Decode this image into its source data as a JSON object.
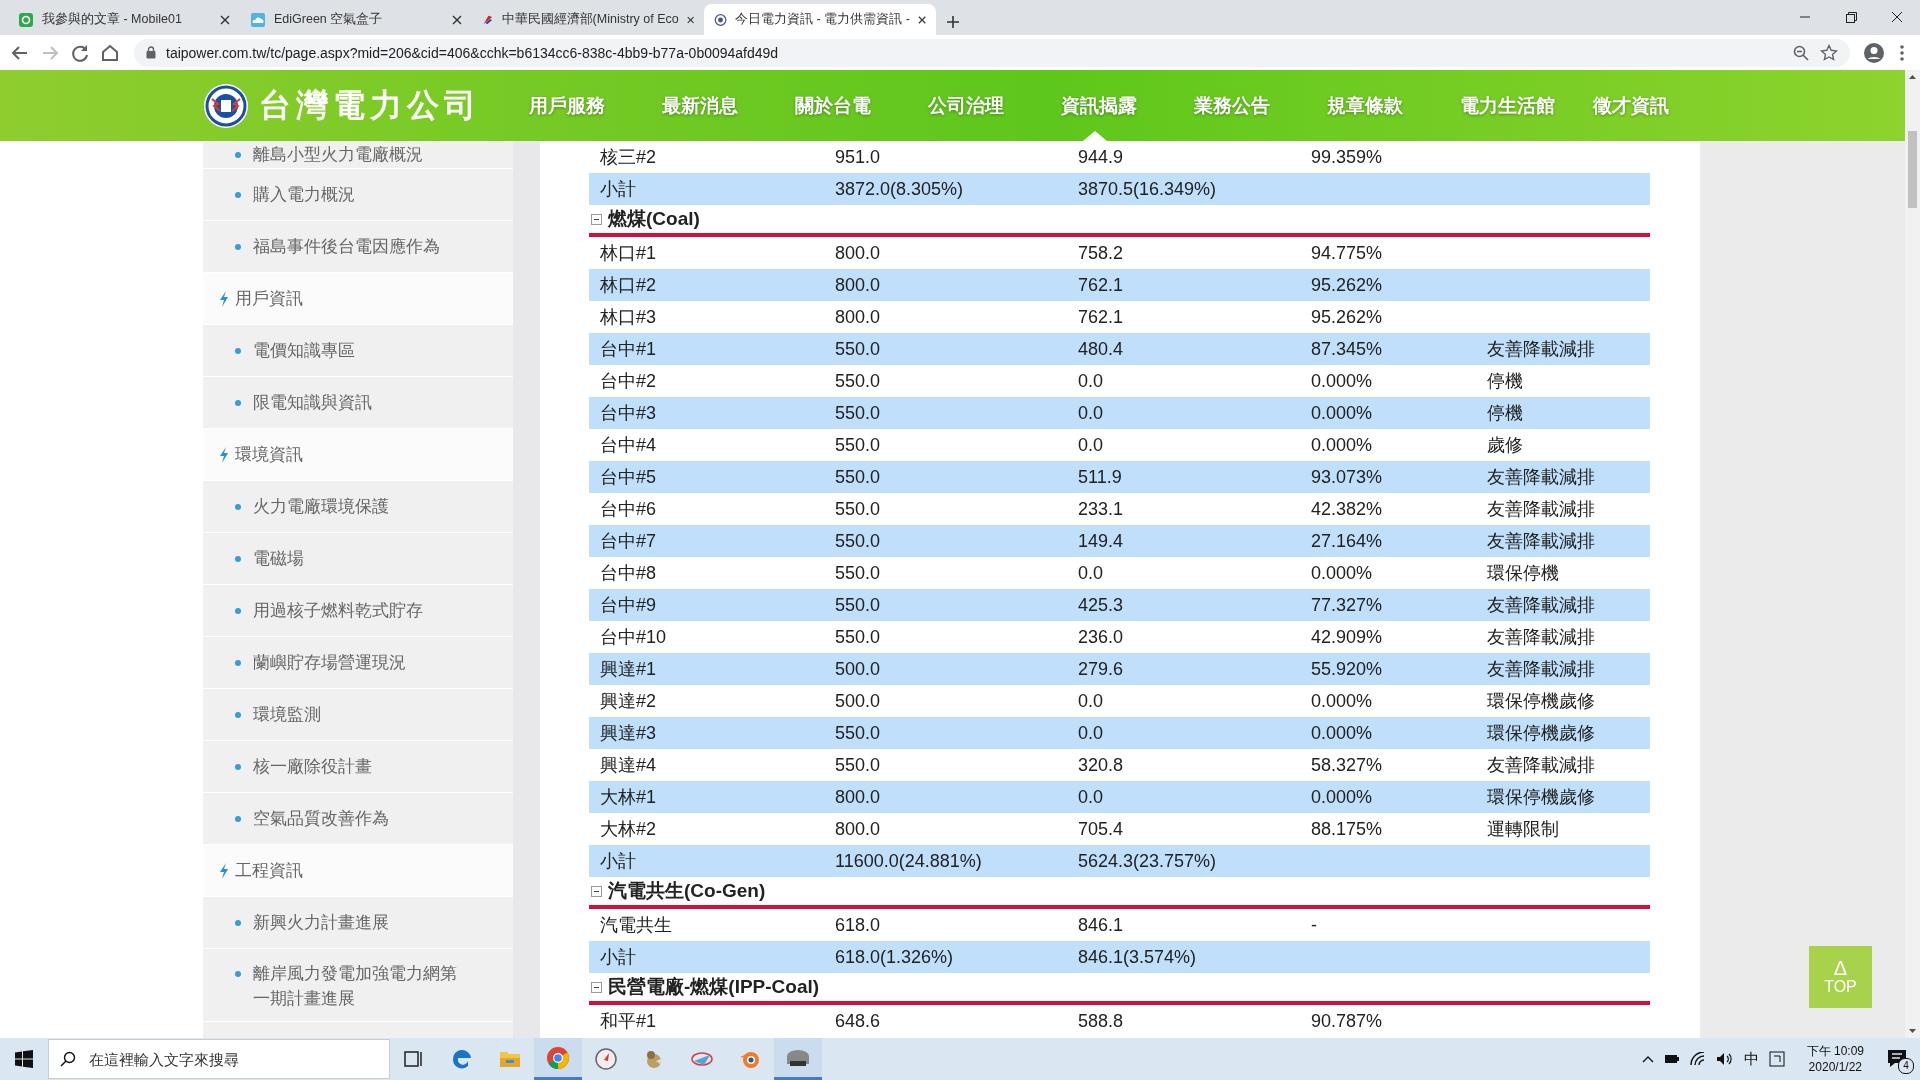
{
  "browser": {
    "tabs": [
      {
        "kind": "square",
        "title": "我參與的文章 - Mobile01",
        "selected": false
      },
      {
        "kind": "cloud",
        "title": "EdiGreen 空氣盒子",
        "selected": false
      },
      {
        "kind": "flag",
        "title": "中華民國經濟部(Ministry of Eco",
        "selected": false
      },
      {
        "kind": "globe",
        "title": "今日電力資訊 - 電力供需資訊 -",
        "selected": true
      }
    ],
    "url": "taipower.com.tw/tc/page.aspx?mid=206&cid=406&cchk=b6134cc6-838c-4bb9-b77a-0b0094afd49d"
  },
  "header": {
    "logo_text": "台灣電力公司",
    "nav": [
      {
        "label": "用戶服務",
        "selected": false
      },
      {
        "label": "最新消息",
        "selected": false
      },
      {
        "label": "關於台電",
        "selected": false
      },
      {
        "label": "公司治理",
        "selected": false
      },
      {
        "label": "資訊揭露",
        "selected": true
      },
      {
        "label": "業務公告",
        "selected": false
      },
      {
        "label": "規章條款",
        "selected": false
      },
      {
        "label": "電力生活館",
        "selected": false
      },
      {
        "label": "徵才資訊",
        "selected": false
      }
    ]
  },
  "sidebar": {
    "items": [
      {
        "kind": "link",
        "label": "離島小型火力電廠概況"
      },
      {
        "kind": "link",
        "label": "購入電力概況"
      },
      {
        "kind": "link",
        "label": "福島事件後台電因應作為"
      },
      {
        "kind": "category",
        "label": "用戶資訊"
      },
      {
        "kind": "link",
        "label": "電價知識專區"
      },
      {
        "kind": "link",
        "label": "限電知識與資訊"
      },
      {
        "kind": "category",
        "label": "環境資訊"
      },
      {
        "kind": "link",
        "label": "火力電廠環境保護"
      },
      {
        "kind": "link",
        "label": "電磁場"
      },
      {
        "kind": "link",
        "label": "用過核子燃料乾式貯存"
      },
      {
        "kind": "link",
        "label": "蘭嶼貯存場營運現況"
      },
      {
        "kind": "link",
        "label": "環境監測"
      },
      {
        "kind": "link",
        "label": "核一廠除役計畫"
      },
      {
        "kind": "link",
        "label": "空氣品質改善作為"
      },
      {
        "kind": "category",
        "label": "工程資訊"
      },
      {
        "kind": "link",
        "label": "新興火力計畫進展"
      },
      {
        "kind": "link",
        "label": "離岸風力發電加強電力網第一期計畫進展"
      }
    ]
  },
  "table": {
    "sections": [
      {
        "rows": [
          [
            "核三#2",
            "951.0",
            "944.9",
            "99.359%"
          ],
          [
            "小計",
            "3872.0(8.305%)",
            "3870.5(16.349%)"
          ]
        ]
      },
      {
        "title": "燃煤(Coal)",
        "expanded": true,
        "rows": [
          [
            "林口#1",
            "800.0",
            "758.2",
            "94.775%"
          ],
          [
            "林口#2",
            "800.0",
            "762.1",
            "95.262%"
          ],
          [
            "林口#3",
            "800.0",
            "762.1",
            "95.262%"
          ],
          [
            "台中#1",
            "550.0",
            "480.4",
            "87.345%",
            "友善降載減排"
          ],
          [
            "台中#2",
            "550.0",
            "0.0",
            "0.000%",
            "停機"
          ],
          [
            "台中#3",
            "550.0",
            "0.0",
            "0.000%",
            "停機"
          ],
          [
            "台中#4",
            "550.0",
            "0.0",
            "0.000%",
            "歲修"
          ],
          [
            "台中#5",
            "550.0",
            "511.9",
            "93.073%",
            "友善降載減排"
          ],
          [
            "台中#6",
            "550.0",
            "233.1",
            "42.382%",
            "友善降載減排"
          ],
          [
            "台中#7",
            "550.0",
            "149.4",
            "27.164%",
            "友善降載減排"
          ],
          [
            "台中#8",
            "550.0",
            "0.0",
            "0.000%",
            "環保停機"
          ],
          [
            "台中#9",
            "550.0",
            "425.3",
            "77.327%",
            "友善降載減排"
          ],
          [
            "台中#10",
            "550.0",
            "236.0",
            "42.909%",
            "友善降載減排"
          ],
          [
            "興達#1",
            "500.0",
            "279.6",
            "55.920%",
            "友善降載減排"
          ],
          [
            "興達#2",
            "500.0",
            "0.0",
            "0.000%",
            "環保停機歲修"
          ],
          [
            "興達#3",
            "550.0",
            "0.0",
            "0.000%",
            "環保停機歲修"
          ],
          [
            "興達#4",
            "550.0",
            "320.8",
            "58.327%",
            "友善降載減排"
          ],
          [
            "大林#1",
            "800.0",
            "0.0",
            "0.000%",
            "環保停機歲修"
          ],
          [
            "大林#2",
            "800.0",
            "705.4",
            "88.175%",
            "運轉限制"
          ],
          [
            "小計",
            "11600.0(24.881%)",
            "5624.3(23.757%)"
          ]
        ]
      },
      {
        "title": "汽電共生(Co-Gen)",
        "expanded": true,
        "rows": [
          [
            "汽電共生",
            "618.0",
            "846.1",
            "-"
          ],
          [
            "小計",
            "618.0(1.326%)",
            "846.1(3.574%)"
          ]
        ]
      },
      {
        "title": "民營電廠-燃煤(IPP-Coal)",
        "expanded": true,
        "rows": [
          [
            "和平#1",
            "648.6",
            "588.8",
            "90.787%"
          ]
        ]
      }
    ]
  },
  "top_button": {
    "glyph": "Δ",
    "label": "TOP"
  },
  "taskbar": {
    "search": {
      "placeholder": "在這裡輸入文字來搜尋"
    },
    "apps": [
      {
        "kind": "taskview",
        "running": false
      },
      {
        "kind": "edge",
        "running": false
      },
      {
        "kind": "folder",
        "running": false
      },
      {
        "kind": "chrome",
        "running": true
      },
      {
        "kind": "compass",
        "running": false
      },
      {
        "kind": "bird",
        "running": false
      },
      {
        "kind": "plane",
        "running": false
      },
      {
        "kind": "blender",
        "running": false
      },
      {
        "kind": "car",
        "running": true
      }
    ],
    "ime": "中",
    "time": "下午 10:09",
    "date": "2020/1/22",
    "notifications": "4"
  }
}
